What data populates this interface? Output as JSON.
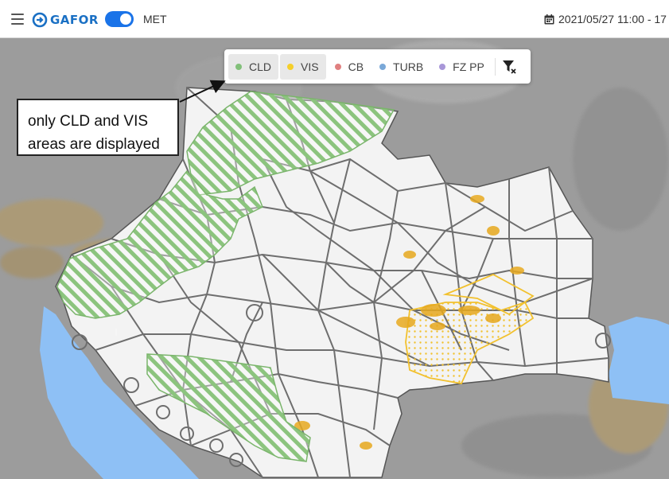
{
  "header": {
    "menu_icon": "hamburger-menu-icon",
    "logo_text": "GAFOR",
    "toggle_label": "MET",
    "toggle_on": true,
    "datetime": "2021/05/27 11:00 - 17"
  },
  "legend": {
    "items": [
      {
        "label": "CLD",
        "color": "#82c07a",
        "active": true
      },
      {
        "label": "VIS",
        "color": "#f5cf2a",
        "active": true
      },
      {
        "label": "CB",
        "color": "#e08080",
        "active": false
      },
      {
        "label": "TURB",
        "color": "#7aa8d8",
        "active": false
      },
      {
        "label": "FZ PP",
        "color": "#a897d8",
        "active": false
      }
    ],
    "clear_filter_icon": "filter-clear-icon"
  },
  "annotation": {
    "line1": "only CLD and VIS",
    "line2": "areas are displayed"
  },
  "colors": {
    "accent": "#1a73e8",
    "cld_hatch": "#8cc47e",
    "vis_hatch": "#f2c12e",
    "sea": "#8ec0f5",
    "grid_lines": "#6e6e6e"
  }
}
